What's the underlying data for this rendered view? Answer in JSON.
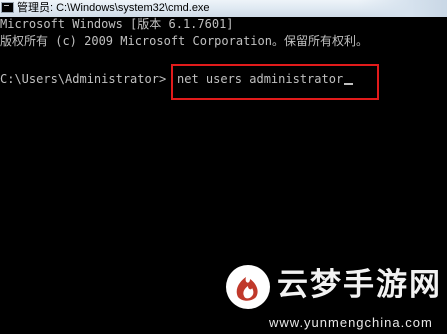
{
  "window": {
    "title": "管理员: C:\\Windows\\system32\\cmd.exe",
    "title_icon": "cmd-console-icon"
  },
  "console": {
    "lines": [
      "Microsoft Windows [版本 6.1.7601]",
      "版权所有 (c) 2009 Microsoft Corporation。保留所有权利。"
    ],
    "prompt": "C:\\Users\\Administrator>",
    "command": "net users administrator",
    "text_color": "#c0c0c0",
    "background_color": "#000000"
  },
  "annotation": {
    "highlight_color": "#e21b1b"
  },
  "watermark": {
    "brand": "云梦手游网",
    "url": "www.yunmengchina.com",
    "logo_icon": "flame-logo-icon",
    "logo_color": "#c0392b"
  }
}
